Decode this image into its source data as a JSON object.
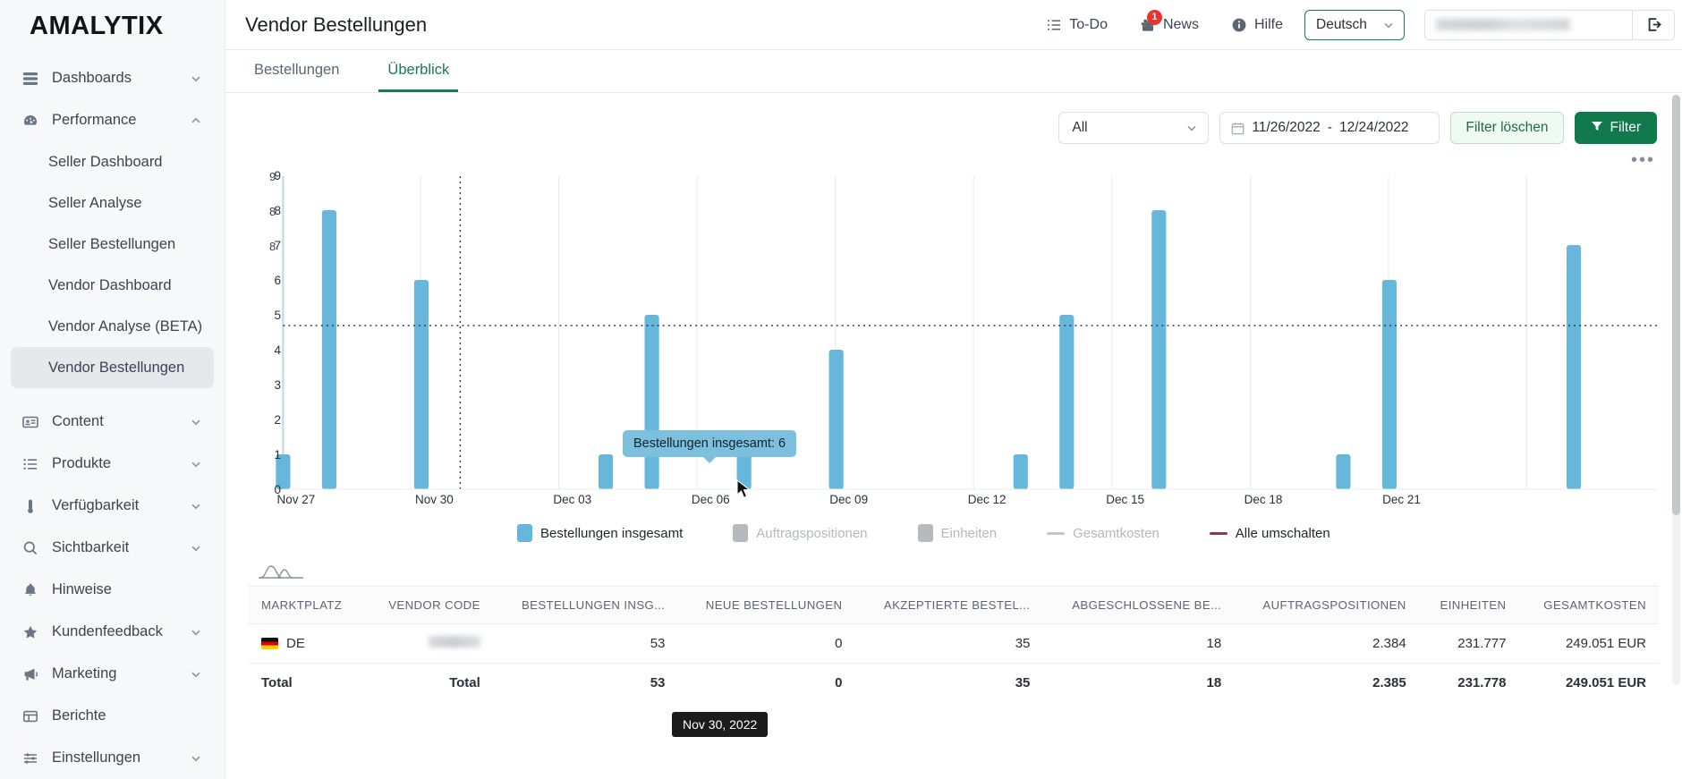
{
  "brand": {
    "name": "AMALYTIX"
  },
  "sidebar": {
    "items": [
      {
        "label": "Dashboards",
        "icon": "dashboards-icon",
        "expandable": true,
        "expanded": false
      },
      {
        "label": "Performance",
        "icon": "performance-icon",
        "expandable": true,
        "expanded": true
      },
      {
        "label": "Content",
        "icon": "content-icon",
        "expandable": true,
        "expanded": false
      },
      {
        "label": "Produkte",
        "icon": "products-icon",
        "expandable": true,
        "expanded": false
      },
      {
        "label": "Verfügbarkeit",
        "icon": "availability-icon",
        "expandable": true,
        "expanded": false
      },
      {
        "label": "Sichtbarkeit",
        "icon": "visibility-icon",
        "expandable": true,
        "expanded": false
      },
      {
        "label": "Hinweise",
        "icon": "bell-icon",
        "expandable": false,
        "expanded": false
      },
      {
        "label": "Kundenfeedback",
        "icon": "star-icon",
        "expandable": true,
        "expanded": false
      },
      {
        "label": "Marketing",
        "icon": "megaphone-icon",
        "expandable": true,
        "expanded": false
      },
      {
        "label": "Berichte",
        "icon": "reports-icon",
        "expandable": false,
        "expanded": false
      },
      {
        "label": "Einstellungen",
        "icon": "settings-icon",
        "expandable": true,
        "expanded": false
      }
    ],
    "performance_children": [
      {
        "label": "Seller Dashboard",
        "active": false
      },
      {
        "label": "Seller Analyse",
        "active": false
      },
      {
        "label": "Seller Bestellungen",
        "active": false
      },
      {
        "label": "Vendor Dashboard",
        "active": false
      },
      {
        "label": "Vendor Analyse (BETA)",
        "active": false
      },
      {
        "label": "Vendor Bestellungen",
        "active": true
      }
    ]
  },
  "header": {
    "title": "Vendor Bestellungen",
    "todo": "To-Do",
    "news": "News",
    "news_badge": "1",
    "help": "Hilfe",
    "language": "Deutsch",
    "account_value": ""
  },
  "tabs": [
    {
      "label": "Bestellungen",
      "active": false
    },
    {
      "label": "Überblick",
      "active": true
    }
  ],
  "filters": {
    "marketplace_selected": "All",
    "date_from": "11/26/2022",
    "date_to": "12/24/2022",
    "date_separator": "-",
    "clear_label": "Filter löschen",
    "apply_label": "Filter",
    "kebab": "•••"
  },
  "chart_data": {
    "type": "bar",
    "title": "",
    "xlabel": "",
    "ylabel": "",
    "ylim": [
      0,
      9
    ],
    "yticks": [
      0,
      1,
      2,
      3,
      4,
      5,
      6,
      7,
      8,
      9
    ],
    "xticks": [
      "Nov 27",
      "Nov 30",
      "Dec 03",
      "Dec 06",
      "Dec 09",
      "Dec 12",
      "Dec 15",
      "Dec 18",
      "Dec 21"
    ],
    "grid": true,
    "legend_position": "bottom",
    "series": [
      {
        "name": "Bestellungen insgesamt",
        "color": "#67b7dc",
        "active": true,
        "categories": [
          "Nov 26",
          "Nov 27",
          "Nov 28",
          "Nov 29",
          "Nov 30",
          "Dec 01",
          "Dec 02",
          "Dec 03",
          "Dec 04",
          "Dec 05",
          "Dec 06",
          "Dec 07",
          "Dec 08",
          "Dec 09",
          "Dec 10",
          "Dec 11",
          "Dec 12",
          "Dec 13",
          "Dec 14",
          "Dec 15",
          "Dec 16",
          "Dec 17",
          "Dec 18",
          "Dec 19",
          "Dec 20",
          "Dec 21",
          "Dec 22",
          "Dec 23",
          "Dec 24"
        ],
        "values": [
          0,
          1,
          8,
          0,
          6,
          0,
          1,
          5,
          0,
          1,
          0,
          4,
          0,
          0,
          0,
          1,
          5,
          0,
          8,
          0,
          0,
          0,
          1,
          6,
          0,
          7,
          0,
          0,
          0
        ]
      },
      {
        "name": "Auftragspositionen",
        "color": "#b0b0b0",
        "active": false,
        "values": []
      },
      {
        "name": "Einheiten",
        "color": "#b0b0b0",
        "active": false,
        "values": []
      },
      {
        "name": "Gesamtkosten",
        "color": "#b9bcc0",
        "active": false,
        "type": "line",
        "values": []
      }
    ],
    "legend": [
      {
        "label": "Bestellungen insgesamt",
        "marker": "square",
        "color": "#67b7dc",
        "active": true
      },
      {
        "label": "Auftragspositionen",
        "marker": "square",
        "color": "#b6b9bd",
        "active": false
      },
      {
        "label": "Einheiten",
        "marker": "square",
        "color": "#b6b9bd",
        "active": false
      },
      {
        "label": "Gesamtkosten",
        "marker": "line",
        "color": "#c3c6ca",
        "active": false
      },
      {
        "label": "Alle umschalten",
        "marker": "line",
        "color": "#8d3a45",
        "active": true
      }
    ],
    "tooltip_value": "Bestellungen insgesamt: 6",
    "tooltip_date": "Nov 30, 2022",
    "cursor_guide_value": 5.55
  },
  "table": {
    "columns": [
      {
        "label": "MARKTPLATZ",
        "align": "left"
      },
      {
        "label": "VENDOR CODE",
        "align": "right"
      },
      {
        "label": "BESTELLUNGEN INSG...",
        "align": "right"
      },
      {
        "label": "NEUE BESTELLUNGEN",
        "align": "right"
      },
      {
        "label": "AKZEPTIERTE BESTEL...",
        "align": "right"
      },
      {
        "label": "ABGESCHLOSSENE BE...",
        "align": "right"
      },
      {
        "label": "AUFTRAGSPOSITIONEN",
        "align": "right"
      },
      {
        "label": "EINHEITEN",
        "align": "right"
      },
      {
        "label": "GESAMTKOSTEN",
        "align": "right"
      }
    ],
    "rows": [
      {
        "marketplace": "DE",
        "vendor_code": "",
        "orders_total": "53",
        "new_orders": "0",
        "accepted_orders": "35",
        "completed_orders": "18",
        "order_positions": "2.384",
        "units": "231.777",
        "total_cost": "249.051 EUR"
      }
    ],
    "total_row": {
      "marketplace": "Total",
      "vendor_code": "Total",
      "orders_total": "53",
      "new_orders": "0",
      "accepted_orders": "35",
      "completed_orders": "18",
      "order_positions": "2.385",
      "units": "231.778",
      "total_cost": "249.051 EUR"
    }
  },
  "colors": {
    "brand_green": "#107a4d",
    "bar_blue": "#67b7dc",
    "badge_red": "#e8342a",
    "toggle_red": "#8d3a45"
  }
}
